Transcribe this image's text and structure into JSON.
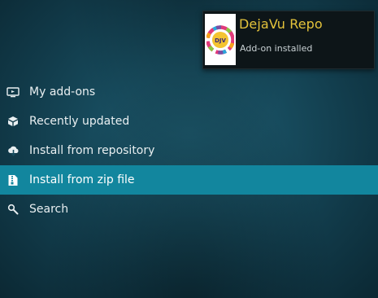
{
  "notification": {
    "title": "DejaVu Repo",
    "message": "Add-on installed",
    "icon": "dejavu-logo-icon",
    "icon_text": "DJV"
  },
  "menu": {
    "items": [
      {
        "label": "My add-ons",
        "icon": "monitor-icon",
        "selected": false
      },
      {
        "label": "Recently updated",
        "icon": "box-icon",
        "selected": false
      },
      {
        "label": "Install from repository",
        "icon": "cloud-download-icon",
        "selected": false
      },
      {
        "label": "Install from zip file",
        "icon": "zip-file-icon",
        "selected": true
      },
      {
        "label": "Search",
        "icon": "search-icon",
        "selected": false
      }
    ]
  },
  "colors": {
    "selected_row": "#12869e",
    "notification_title": "#e4c33b",
    "background": "#174b5d"
  }
}
